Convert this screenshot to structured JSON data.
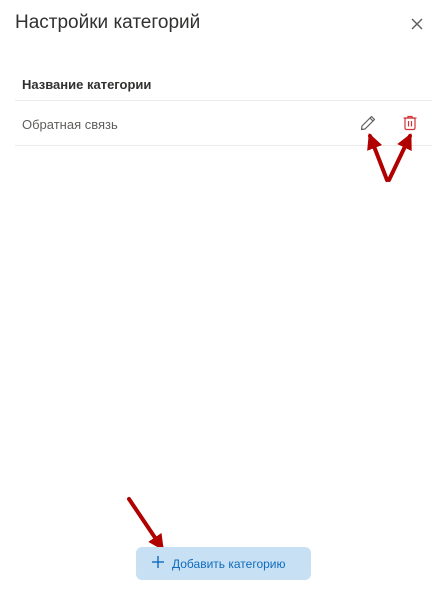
{
  "panel": {
    "title": "Настройки категорий",
    "close_icon": "close-icon"
  },
  "table": {
    "column_header": "Название категории",
    "rows": [
      {
        "label": "Обратная связь",
        "edit_icon": "pencil-icon",
        "delete_icon": "trash-icon"
      }
    ]
  },
  "footer": {
    "add_button_label": "Добавить категорию",
    "add_icon": "plus-icon"
  },
  "colors": {
    "accent": "#0f6cbd",
    "button_bg": "#c7e0f4",
    "delete": "#d13438",
    "annotation_arrow": "#b00000"
  }
}
